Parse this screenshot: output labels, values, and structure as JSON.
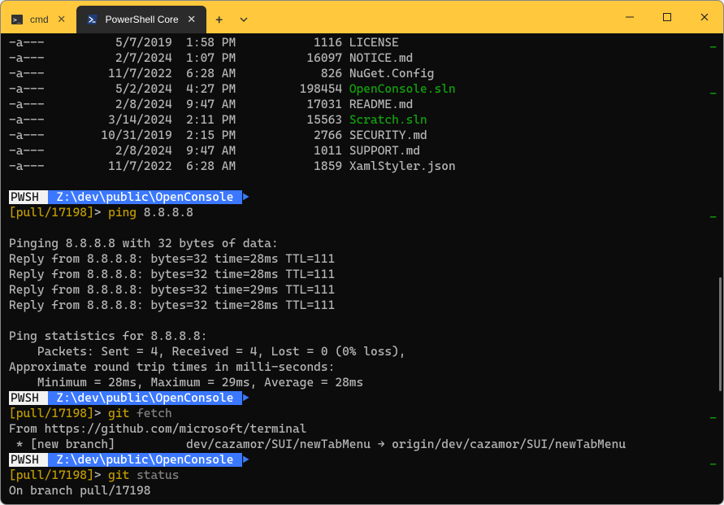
{
  "window": {
    "tabs": [
      {
        "label": "cmd",
        "active": false
      },
      {
        "label": "PowerShell Core",
        "active": true
      }
    ]
  },
  "files": [
    {
      "mode": "-a---",
      "date": "5/7/2019",
      "time": "1:58 PM",
      "size": "1116",
      "name": "LICENSE",
      "green": false
    },
    {
      "mode": "-a---",
      "date": "2/7/2024",
      "time": "1:07 PM",
      "size": "16097",
      "name": "NOTICE.md",
      "green": false
    },
    {
      "mode": "-a---",
      "date": "11/7/2022",
      "time": "6:28 AM",
      "size": "826",
      "name": "NuGet.Config",
      "green": false
    },
    {
      "mode": "-a---",
      "date": "5/2/2024",
      "time": "4:27 PM",
      "size": "198454",
      "name": "OpenConsole.sln",
      "green": true
    },
    {
      "mode": "-a---",
      "date": "2/8/2024",
      "time": "9:47 AM",
      "size": "17031",
      "name": "README.md",
      "green": false
    },
    {
      "mode": "-a---",
      "date": "3/14/2024",
      "time": "2:11 PM",
      "size": "15563",
      "name": "Scratch.sln",
      "green": true
    },
    {
      "mode": "-a---",
      "date": "10/31/2019",
      "time": "2:15 PM",
      "size": "2766",
      "name": "SECURITY.md",
      "green": false
    },
    {
      "mode": "-a---",
      "date": "2/8/2024",
      "time": "9:47 AM",
      "size": "1011",
      "name": "SUPPORT.md",
      "green": false
    },
    {
      "mode": "-a---",
      "date": "11/7/2022",
      "time": "6:28 AM",
      "size": "1859",
      "name": "XamlStyler.json",
      "green": false
    }
  ],
  "prompt": {
    "shell": "PWSH",
    "path": "Z:\\dev\\public\\OpenConsole",
    "branch_open": "[",
    "branch": "pull/17198",
    "branch_close": "]",
    "caret": ">"
  },
  "cmd1": {
    "exe": "ping",
    "arg": "8.8.8.8"
  },
  "ping": {
    "header": "Pinging 8.8.8.8 with 32 bytes of data:",
    "replies": [
      "Reply from 8.8.8.8: bytes=32 time=28ms TTL=111",
      "Reply from 8.8.8.8: bytes=32 time=28ms TTL=111",
      "Reply from 8.8.8.8: bytes=32 time=29ms TTL=111",
      "Reply from 8.8.8.8: bytes=32 time=28ms TTL=111"
    ],
    "stats_header": "Ping statistics for 8.8.8.8:",
    "packets": "    Packets: Sent = 4, Received = 4, Lost = 0 (0% loss),",
    "approx": "Approximate round trip times in milli-seconds:",
    "minmax": "    Minimum = 28ms, Maximum = 29ms, Average = 28ms"
  },
  "cmd2": {
    "exe": "git",
    "arg": "fetch"
  },
  "fetch": {
    "from": "From https://github.com/microsoft/terminal",
    "branch": " * [new branch]          dev/cazamor/SUI/newTabMenu → origin/dev/cazamor/SUI/newTabMenu"
  },
  "cmd3": {
    "exe": "git",
    "arg": "status"
  },
  "status": {
    "line1": "On branch pull/17198"
  }
}
